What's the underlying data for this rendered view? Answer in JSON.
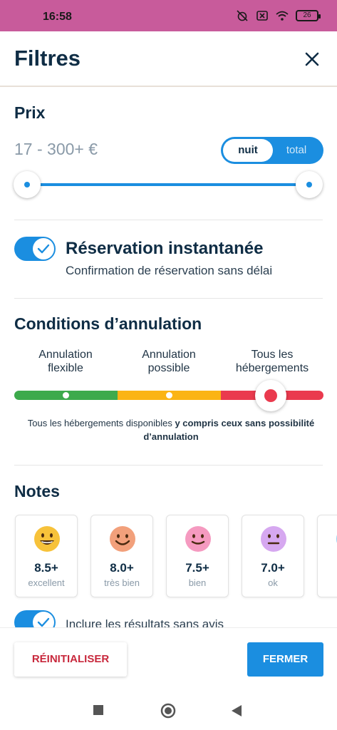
{
  "status_bar": {
    "time": "16:58",
    "battery": "26"
  },
  "header": {
    "title": "Filtres",
    "close_icon": "close-icon"
  },
  "price": {
    "title": "Prix",
    "range": "17 - 300+ €",
    "toggle_options": [
      "nuit",
      "total"
    ],
    "toggle_selected": "nuit",
    "slider_min_fraction": 0,
    "slider_max_fraction": 1
  },
  "instant_booking": {
    "enabled": true,
    "title": "Réservation instantanée",
    "subtitle": "Confirmation de réservation sans délai"
  },
  "cancellation": {
    "title": "Conditions d’annulation",
    "options": [
      {
        "line1": "Annulation",
        "line2": "flexible",
        "color": "#3daa4c"
      },
      {
        "line1": "Annulation",
        "line2": "possible",
        "color": "#fbb414"
      },
      {
        "line1": "Tous les",
        "line2": "hébergements",
        "color": "#ea3a4e"
      }
    ],
    "selected_index": 2,
    "description_plain": "Tous les hébergements disponibles ",
    "description_bold": "y compris ceux sans possibilité d’annulation"
  },
  "notes": {
    "title": "Notes",
    "cards": [
      {
        "score": "8.5+",
        "label": "excellent",
        "icon": "grinning-face-icon",
        "color": "#f7c23a"
      },
      {
        "score": "8.0+",
        "label": "très bien",
        "icon": "smiling-face-icon",
        "color": "#f2a07b"
      },
      {
        "score": "7.5+",
        "label": "bien",
        "icon": "slight-smile-face-icon",
        "color": "#f59ac0"
      },
      {
        "score": "7.0+",
        "label": "ok",
        "icon": "neutral-face-icon",
        "color": "#d6a8f0"
      }
    ],
    "include_without_reviews": {
      "enabled": true,
      "label": "Inclure les résultats sans avis"
    }
  },
  "footer": {
    "reset_label": "RÉINITIALISER",
    "close_label": "FERMER"
  },
  "colors": {
    "accent": "#1b8ee0",
    "title": "#0f2d45",
    "danger": "#c8283c",
    "status_bar": "#c85b9b"
  }
}
